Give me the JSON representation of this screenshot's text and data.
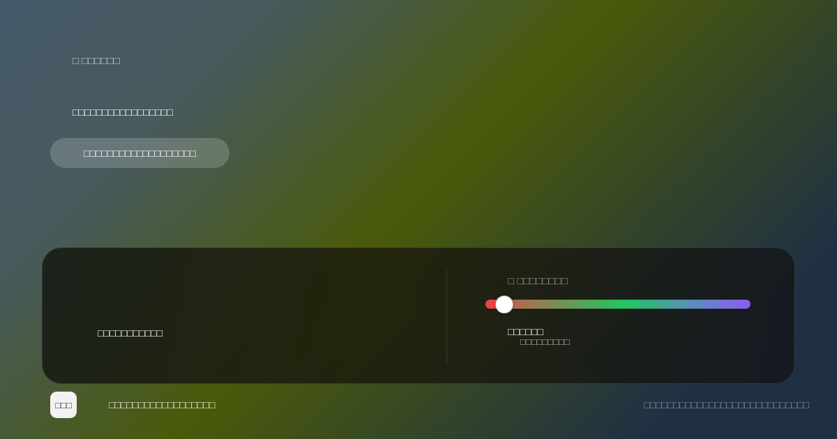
{
  "intro": {
    "eyebrow": "□ □□□□□□",
    "heading": "□□□□□□□□□□□□□□□□□",
    "button": "□□□□□□□□□□□□□□□□□□□"
  },
  "panel": {
    "caption": "□□□□□□□□□□□",
    "slider": {
      "label": "□ □□□□□□□□",
      "level": 0.07,
      "value": "□□□□□□",
      "note": "□□□□□□□□□"
    }
  },
  "footer": {
    "logo": "□□□",
    "title": "□□□□□□□□□□□□□□□□□□",
    "note": "□□□□□□□□□□□□□□□□□□□□□□□□□□□□"
  }
}
